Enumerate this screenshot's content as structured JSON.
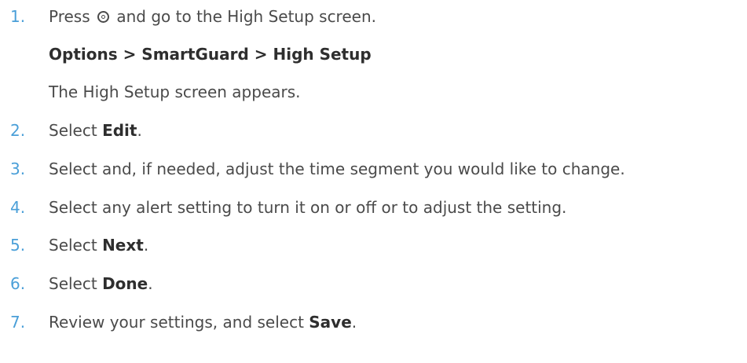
{
  "steps": [
    {
      "number": "1.",
      "text_before": "Press",
      "icon": "select-button-icon",
      "text_after": "and go to the High Setup screen.",
      "path": "Options > SmartGuard > High Setup",
      "result": "The High Setup screen appears."
    },
    {
      "number": "2.",
      "text": "Select ",
      "bold": "Edit",
      "end": "."
    },
    {
      "number": "3.",
      "text": "Select and, if needed, adjust the time segment you would like to change."
    },
    {
      "number": "4.",
      "text": "Select any alert setting to turn it on or off or to adjust the setting."
    },
    {
      "number": "5.",
      "text": "Select ",
      "bold": "Next",
      "end": "."
    },
    {
      "number": "6.",
      "text": "Select ",
      "bold": "Done",
      "end": "."
    },
    {
      "number": "7.",
      "text": "Review your settings, and select ",
      "bold": "Save",
      "end": "."
    }
  ],
  "colors": {
    "step_number": "#4a9fd8",
    "body_text": "#4a4a4a",
    "bold_text": "#2e2e2e"
  }
}
